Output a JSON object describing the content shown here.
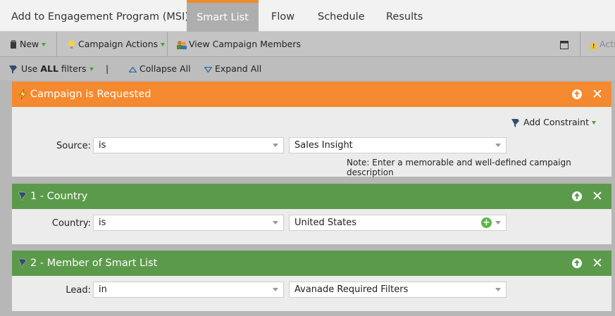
{
  "tabs": [
    {
      "label": "Add to Engagement Program (MSI)",
      "active": false
    },
    {
      "label": "Smart List",
      "active": true
    },
    {
      "label": "Flow",
      "active": false
    },
    {
      "label": "Schedule",
      "active": false
    },
    {
      "label": "Results",
      "active": false
    }
  ],
  "toolbar": {
    "new_label": "New",
    "campaign_actions_label": "Campaign Actions",
    "view_members_label": "View Campaign Members",
    "actions_label": "Acti"
  },
  "filterbar": {
    "use_prefix": "Use ",
    "use_bold": "ALL",
    "use_suffix": " filters",
    "divider": "|",
    "collapse_label": "Collapse All",
    "expand_label": "Expand All"
  },
  "trigger": {
    "title": "Campaign is Requested",
    "add_constraint_label": "Add Constraint",
    "source_label": "Source:",
    "source_operator": "is",
    "source_value": "Sales Insight",
    "note": "Note: Enter a memorable and well-defined campaign description"
  },
  "filters": [
    {
      "title": "1 - Country",
      "field_label": "Country:",
      "operator": "is",
      "value": "United States"
    },
    {
      "title": "2 - Member of Smart List",
      "field_label": "Lead:",
      "operator": "in",
      "value": "Avanade Required Filters"
    }
  ],
  "colors": {
    "accent_orange": "#f5892f",
    "filter_green": "#5c9a4b",
    "dropdown_green": "#4aa02c"
  }
}
